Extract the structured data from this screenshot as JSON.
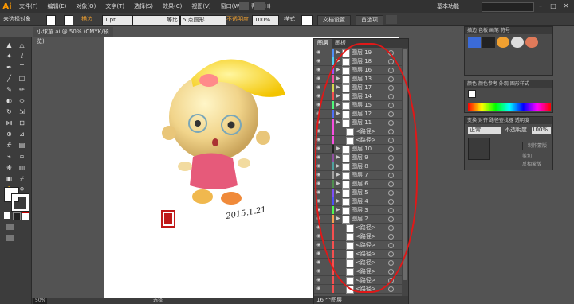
{
  "app": {
    "logo": "Ai",
    "workspace": "基本功能"
  },
  "menu": [
    "文件(F)",
    "编辑(E)",
    "对象(O)",
    "文字(T)",
    "选择(S)",
    "效果(C)",
    "视图(V)",
    "窗口(W)",
    "帮助(H)"
  ],
  "window_controls": {
    "minimize": "–",
    "maximize": "□",
    "close": "✕"
  },
  "control_bar": {
    "selection_status": "未选择对象",
    "stroke_label": "描边",
    "stroke_weight": "1 pt",
    "stroke_style": "等比",
    "brush": "5 点圆形",
    "opacity_label": "不透明度",
    "opacity_value": "100%",
    "style_label": "样式",
    "doc_setup": "文档设置",
    "preferences": "首选项"
  },
  "document_tab": "小球童.ai @ 50% (CMYK/预览)",
  "tools_icons": [
    "selection-icon",
    "direct-selection-icon",
    "magic-wand-icon",
    "lasso-icon",
    "pen-icon",
    "type-icon",
    "line-icon",
    "rectangle-icon",
    "paintbrush-icon",
    "pencil-icon",
    "blob-brush-icon",
    "eraser-icon",
    "rotate-icon",
    "scale-icon",
    "width-icon",
    "free-transform-icon",
    "shape-builder-icon",
    "perspective-icon",
    "mesh-icon",
    "gradient-icon",
    "eyedropper-icon",
    "blend-icon",
    "symbol-sprayer-icon",
    "graph-icon",
    "artboard-icon",
    "slice-icon",
    "hand-icon",
    "zoom-icon"
  ],
  "artwork": {
    "date_text": "2015.1.21",
    "stamp_text": "印"
  },
  "layers_panel": {
    "tabs": [
      "图层",
      "画板"
    ],
    "rows": [
      {
        "name": "图层 19",
        "color": "#4f8ff7"
      },
      {
        "name": "图层 18",
        "color": "#4fd0f7"
      },
      {
        "name": "图层 16",
        "color": "#9f4ff7"
      },
      {
        "name": "图层 13",
        "color": "#f74fa0"
      },
      {
        "name": "图层 17",
        "color": "#d8d84f"
      },
      {
        "name": "图层 14",
        "color": "#f74f4f"
      },
      {
        "name": "图层 15",
        "color": "#4ff77a"
      },
      {
        "name": "图层 12",
        "color": "#4f6ff7"
      },
      {
        "name": "图层 11",
        "color": "#f74fe0"
      },
      {
        "name": "<路径>",
        "color": "#f74fe0"
      },
      {
        "name": "<路径>",
        "color": "#f74fe0"
      },
      {
        "name": "图层 10",
        "color": "#222222"
      },
      {
        "name": "图层 9",
        "color": "#8f4fa0"
      },
      {
        "name": "图层 8",
        "color": "#4fa0a0"
      },
      {
        "name": "图层 7",
        "color": "#a0a0a0"
      },
      {
        "name": "图层 6",
        "color": "#4f8f4f"
      },
      {
        "name": "图层 5",
        "color": "#7f4ff7"
      },
      {
        "name": "图层 4",
        "color": "#4f4ff7"
      },
      {
        "name": "图层 3",
        "color": "#4ff74f"
      },
      {
        "name": "图层 2",
        "color": "#f7a04f"
      },
      {
        "name": "<路径>",
        "color": "#f74f4f"
      },
      {
        "name": "<路径>",
        "color": "#f74f4f"
      },
      {
        "name": "<路径>",
        "color": "#f74f4f"
      },
      {
        "name": "<路径>",
        "color": "#f74f4f"
      },
      {
        "name": "<路径>",
        "color": "#f74f4f"
      },
      {
        "name": "<路径>",
        "color": "#f74f4f"
      },
      {
        "name": "<路径>",
        "color": "#f74f4f"
      },
      {
        "name": "<路径>",
        "color": "#f74f4f"
      }
    ],
    "footer": "16 个图层"
  },
  "right_panels": {
    "brush_tabs": [
      "描边",
      "色板",
      "画笔",
      "符号"
    ],
    "color_tabs": [
      "颜色",
      "颜色参考",
      "外观",
      "图形样式"
    ],
    "transparency_tabs": [
      "变换",
      "对齐",
      "路径查找器",
      "透明度"
    ],
    "blend_mode": "正常",
    "opacity_label": "不透明度",
    "opacity_value": "100%",
    "make_mask": "制作蒙版",
    "clip": "剪切",
    "invert_mask": "反相蒙版"
  },
  "status_bar": {
    "zoom": "50%",
    "tool": "选择"
  }
}
